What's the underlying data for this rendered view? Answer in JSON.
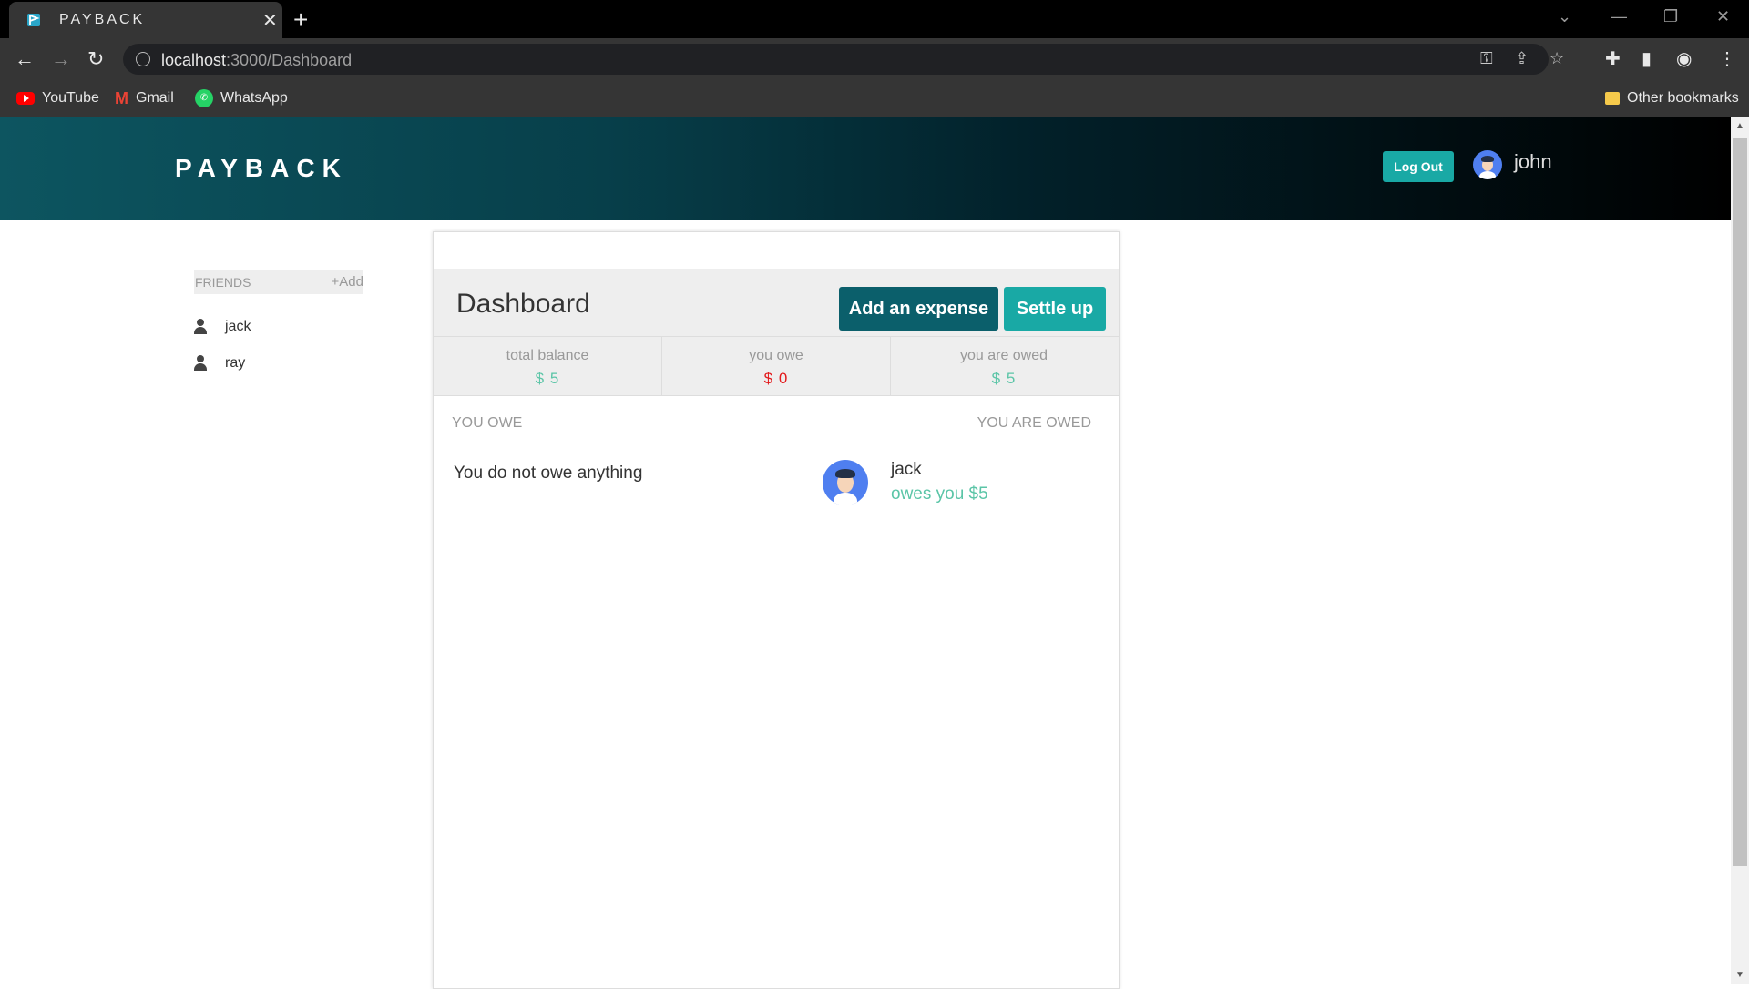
{
  "browser": {
    "tab_title": "PAYBACK",
    "url_host": "localhost",
    "url_path": ":3000/Dashboard",
    "bookmarks": [
      "YouTube",
      "Gmail",
      "WhatsApp"
    ],
    "other_bookmarks": "Other bookmarks"
  },
  "header": {
    "brand": "PAYBACK",
    "logout_label": "Log Out",
    "username": "john"
  },
  "sidebar": {
    "friends_label": "FRIENDS",
    "add_label": "+Add",
    "friends": [
      "jack",
      "ray"
    ]
  },
  "dashboard": {
    "title": "Dashboard",
    "add_expense_label": "Add an expense",
    "settle_up_label": "Settle up",
    "balances": [
      {
        "label": "total balance",
        "value": "$ 5",
        "color": "#5bc5a7"
      },
      {
        "label": "you owe",
        "value": "$ 0",
        "color": "#e31a1c"
      },
      {
        "label": "you are owed",
        "value": "$ 5",
        "color": "#5bc5a7"
      }
    ],
    "you_owe_label": "YOU OWE",
    "you_are_owed_label": "YOU ARE OWED",
    "nothing_owed": "You do not owe anything",
    "owed_by": [
      {
        "name": "jack",
        "detail": "owes you $5"
      }
    ]
  }
}
